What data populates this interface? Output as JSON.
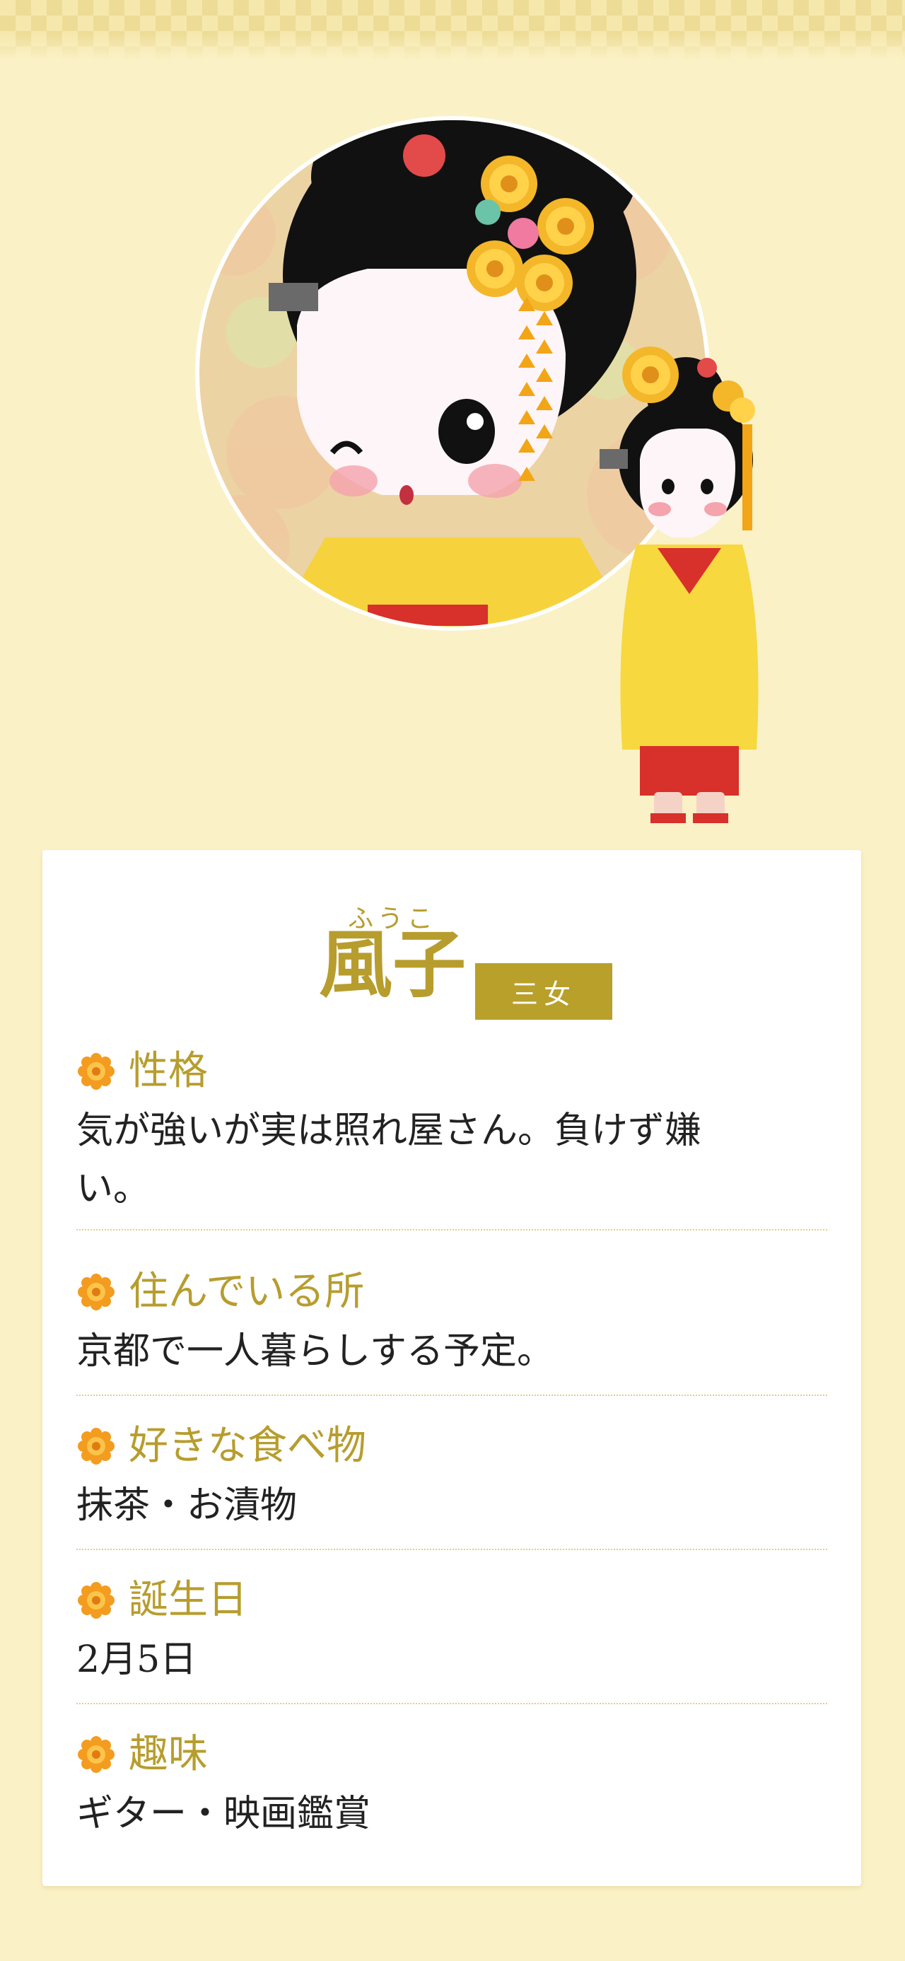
{
  "profile": {
    "ruby": "ふうこ",
    "name": "風子",
    "badge": "三女"
  },
  "colors": {
    "accent": "#b79d2e",
    "background": "#faf1c6",
    "card": "#ffffff",
    "text": "#222222"
  },
  "sections": [
    {
      "title": "性格",
      "icon": "orange-flower-icon",
      "body": "気が強いが実は照れ屋さん。負けず嫌\nい。"
    },
    {
      "title": "住んでいる所",
      "icon": "orange-flower-icon",
      "body": "京都で一人暮らしする予定。"
    },
    {
      "title": "好きな食べ物",
      "icon": "orange-flower-icon",
      "body": "抹茶・お漬物"
    },
    {
      "title": "誕生日",
      "icon": "orange-flower-icon",
      "body": "2月5日"
    },
    {
      "title": "趣味",
      "icon": "orange-flower-icon",
      "body": "ギター・映画鑑賞"
    }
  ]
}
